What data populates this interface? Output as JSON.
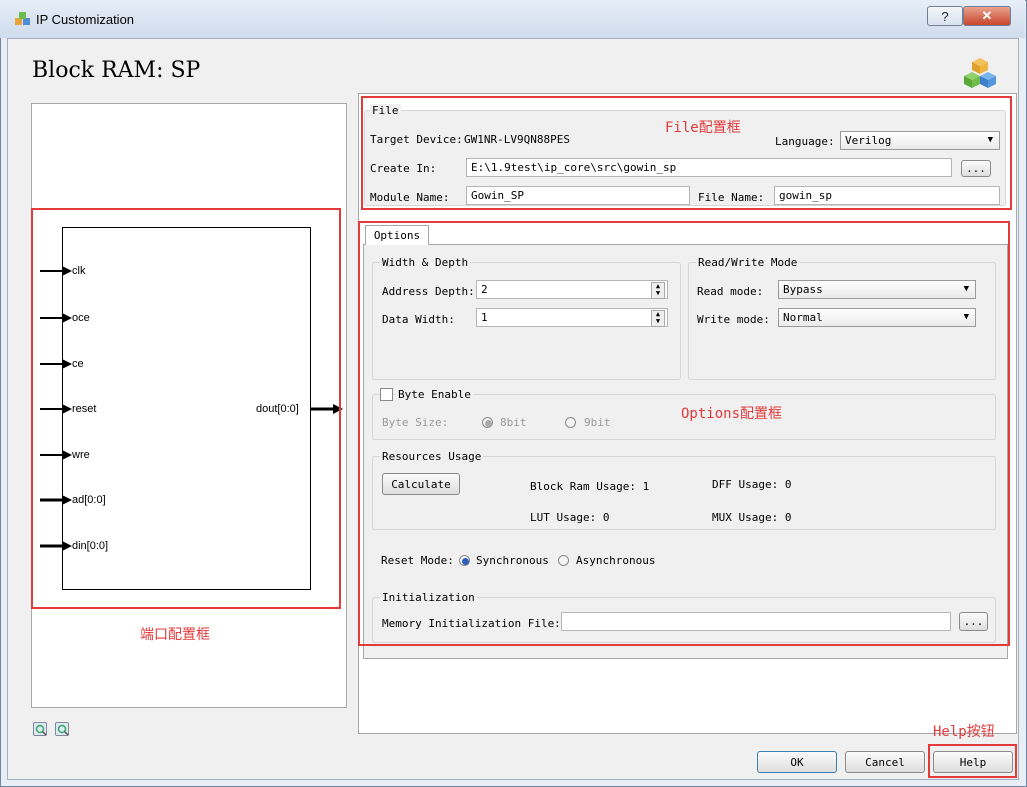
{
  "window": {
    "title": "IP Customization",
    "help_glyph": "?",
    "close_glyph": "✕"
  },
  "header": {
    "title": "Block RAM: SP"
  },
  "ports": {
    "inputs": [
      "clk",
      "oce",
      "ce",
      "reset",
      "wre",
      "ad[0:0]",
      "din[0:0]"
    ],
    "output": "dout[0:0]"
  },
  "annotations": {
    "port_frame": "端口配置框",
    "file_frame": "File配置框",
    "options_frame": "Options配置框",
    "help_button": "Help按钮"
  },
  "file": {
    "legend": "File",
    "target_device_label": "Target Device:",
    "target_device_value": "GW1NR-LV9QN88PES",
    "language_label": "Language:",
    "language_value": "Verilog",
    "create_in_label": "Create In:",
    "create_in_value": "E:\\1.9test\\ip_core\\src\\gowin_sp",
    "browse_label": "...",
    "module_name_label": "Module Name:",
    "module_name_value": "Gowin_SP",
    "file_name_label": "File Name:",
    "file_name_value": "gowin_sp"
  },
  "options": {
    "tab_label": "Options",
    "width_depth": {
      "legend": "Width & Depth",
      "address_depth_label": "Address Depth:",
      "address_depth_value": "2",
      "data_width_label": "Data Width:",
      "data_width_value": "1"
    },
    "rw_mode": {
      "legend": "Read/Write Mode",
      "read_label": "Read mode:",
      "read_value": "Bypass",
      "write_label": "Write mode:",
      "write_value": "Normal"
    },
    "byte_enable": {
      "legend": "Byte Enable",
      "checked": false,
      "byte_size_label": "Byte Size:",
      "opt_8bit": "8bit",
      "opt_9bit": "9bit"
    },
    "resources": {
      "legend": "Resources Usage",
      "calculate_label": "Calculate",
      "block_ram": "Block Ram Usage: 1",
      "dff": "DFF Usage: 0",
      "lut": "LUT Usage: 0",
      "mux": "MUX Usage: 0"
    },
    "reset_mode": {
      "label": "Reset Mode:",
      "sync": "Synchronous",
      "async": "Asynchronous",
      "selected": "Synchronous"
    },
    "initialization": {
      "legend": "Initialization",
      "file_label": "Memory Initialization File:",
      "file_value": "",
      "browse_label": "..."
    }
  },
  "footer": {
    "ok": "OK",
    "cancel": "Cancel",
    "help": "Help"
  },
  "colors": {
    "annotation_red": "#e33a3a",
    "radio_on": "#2d5fbd"
  }
}
